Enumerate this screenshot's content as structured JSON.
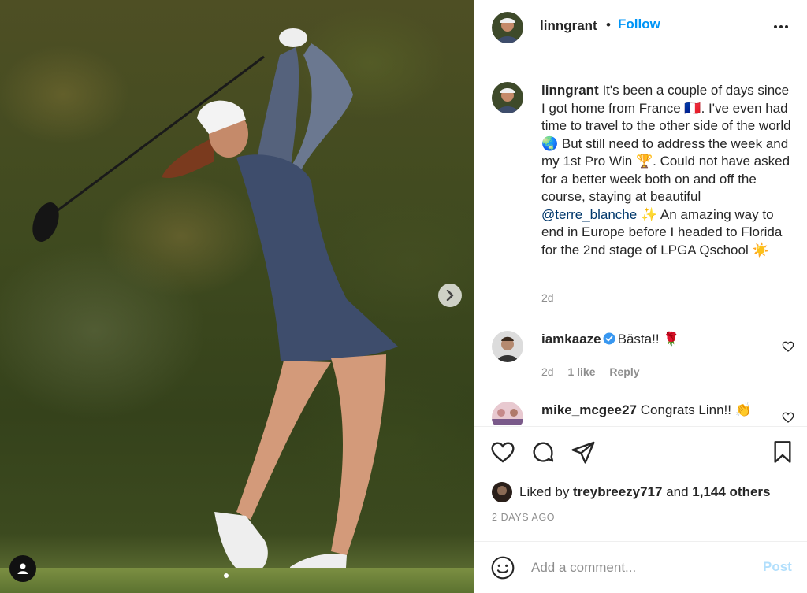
{
  "post": {
    "image_alt_icons": {
      "tag_people": "person-icon",
      "next": "chevron-right-icon"
    }
  },
  "header": {
    "username": "linngrant",
    "separator": "•",
    "follow_label": "Follow",
    "more_icon": "more-horizontal-icon"
  },
  "caption": {
    "username": "linngrant",
    "text_part1": " It's been a couple of days since I got home from France 🇫🇷. I've even had time to travel to the other side of the world 🌏 But still need to address the week and my 1st Pro Win 🏆. Could not have asked for a better week both on and off the course, staying at beautiful ",
    "mention": "@terre_blanche",
    "text_part2": " ✨ An amazing way to end in Europe before I headed to Florida for the 2nd stage of LPGA Qschool ☀️",
    "time": "2d"
  },
  "comments": [
    {
      "username": "iamkaaze",
      "verified": true,
      "text": "Bästa!! 🌹",
      "time": "2d",
      "likes": "1 like",
      "reply_label": "Reply"
    },
    {
      "username": "mike_mcgee27",
      "verified": false,
      "text": "Congrats Linn!! 👏"
    }
  ],
  "actions": {
    "like_icon": "heart-icon",
    "comment_icon": "comment-bubble-icon",
    "share_icon": "paper-plane-icon",
    "save_icon": "bookmark-icon"
  },
  "likes": {
    "prefix": "Liked by ",
    "user": "treybreezy717",
    "middle": " and ",
    "others": "1,144 others"
  },
  "post_time": "2 DAYS AGO",
  "comment_box": {
    "placeholder": "Add a comment...",
    "post_label": "Post",
    "emoji_icon": "smiley-icon"
  },
  "colors": {
    "follow": "#0095f6",
    "mention": "#00376b",
    "muted": "#8e8e8e",
    "post_disabled": "#b2dffc",
    "verified": "#3897f0"
  }
}
